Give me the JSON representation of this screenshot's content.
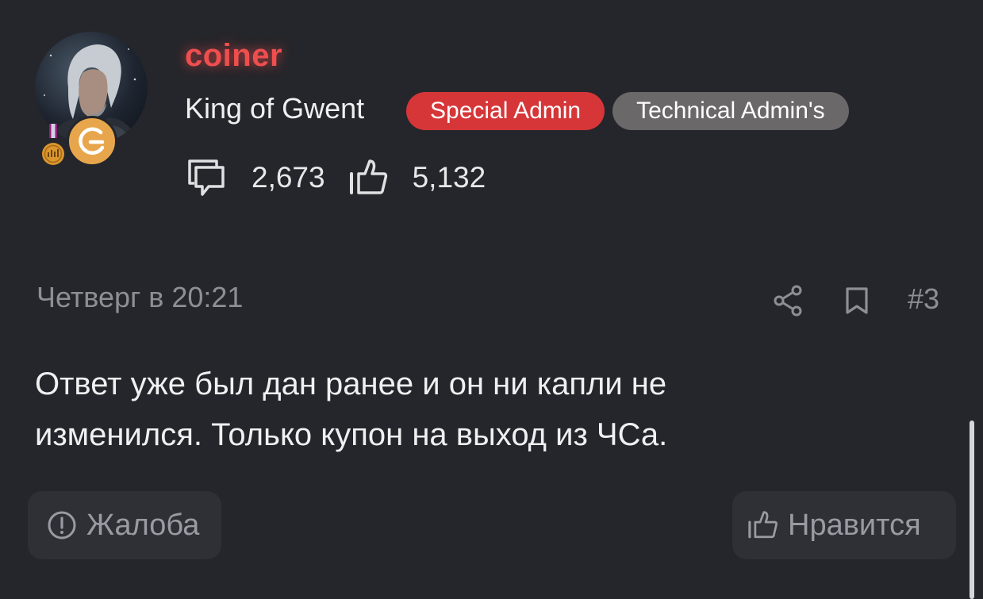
{
  "author": {
    "username": "coiner",
    "title": "King of Gwent",
    "badges": [
      {
        "label": "Special Admin",
        "color": "#d63638"
      },
      {
        "label": "Technical Admin's",
        "color": "#6b6869"
      }
    ],
    "stats": {
      "messages": "2,673",
      "likes": "5,132"
    },
    "avatar_icon": "witcher-avatar",
    "award_icon": "medal-icon",
    "brand_icon": "brand-g-icon"
  },
  "post": {
    "date": "Четверг в 20:21",
    "number": "#3",
    "text": "Ответ уже был дан ранее и он ни капли не изменился. Только купон на выход из ЧСа."
  },
  "actions": {
    "report_label": "Жалоба",
    "like_label": "Нравится"
  },
  "colors": {
    "background": "#25262b",
    "username": "#ef4e4e",
    "muted": "#8e8f96",
    "button_bg": "#2f3036"
  }
}
